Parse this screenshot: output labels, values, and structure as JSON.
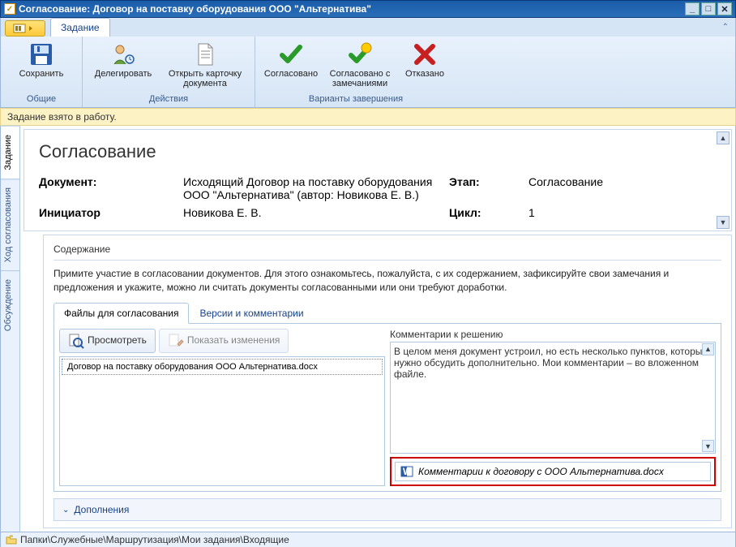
{
  "window": {
    "title": "Согласование: Договор на поставку оборудования ООО \"Альтернатива\""
  },
  "ribbon": {
    "tab": "Задание",
    "groups": {
      "common": {
        "title": "Общие",
        "save": "Сохранить"
      },
      "actions": {
        "title": "Действия",
        "delegate": "Делегировать",
        "open_card": "Открыть карточку документа"
      },
      "finish": {
        "title": "Варианты завершения",
        "agreed": "Согласовано",
        "agreed_notes": "Согласовано с замечаниями",
        "declined": "Отказано"
      }
    }
  },
  "status": "Задание взято в работу.",
  "header": {
    "heading": "Согласование",
    "labels": {
      "doc": "Документ:",
      "stage": "Этап:",
      "initiator": "Инициатор",
      "cycle": "Цикл:"
    },
    "doc": "Исходящий Договор на поставку оборудования ООО \"Альтернатива\" (автор: Новикова Е. В.)",
    "stage": "Согласование",
    "initiator": "Новикова Е. В.",
    "cycle": "1"
  },
  "side_tabs": {
    "task": "Задание",
    "flow": "Ход согласования",
    "discuss": "Обсуждение"
  },
  "body": {
    "section_title": "Содержание",
    "instruction": "Примите участие в согласовании документов. Для этого ознакомьтесь, пожалуйста, с их содержанием, зафиксируйте свои замечания и предложения и укажите, можно ли считать документы согласованными или они требуют доработки.",
    "inner_tabs": {
      "files": "Файлы для согласования",
      "versions": "Версии и комментарии"
    },
    "toolbar": {
      "view": "Просмотреть",
      "changes": "Показать изменения"
    },
    "file": "Договор на поставку оборудования ООО Альтернатива.docx",
    "comment_label": "Комментарии к решению",
    "comment_text": "В целом меня документ устроил, но есть несколько пунктов, которые нужно обсудить дополнительно. Мои комментарии – во вложенном файле.",
    "attachment": "Комментарии к договору с ООО Альтернатива.docx",
    "addenda": "Дополнения"
  },
  "breadcrumb": "Папки\\Служебные\\Маршрутизация\\Мои задания\\Входящие"
}
